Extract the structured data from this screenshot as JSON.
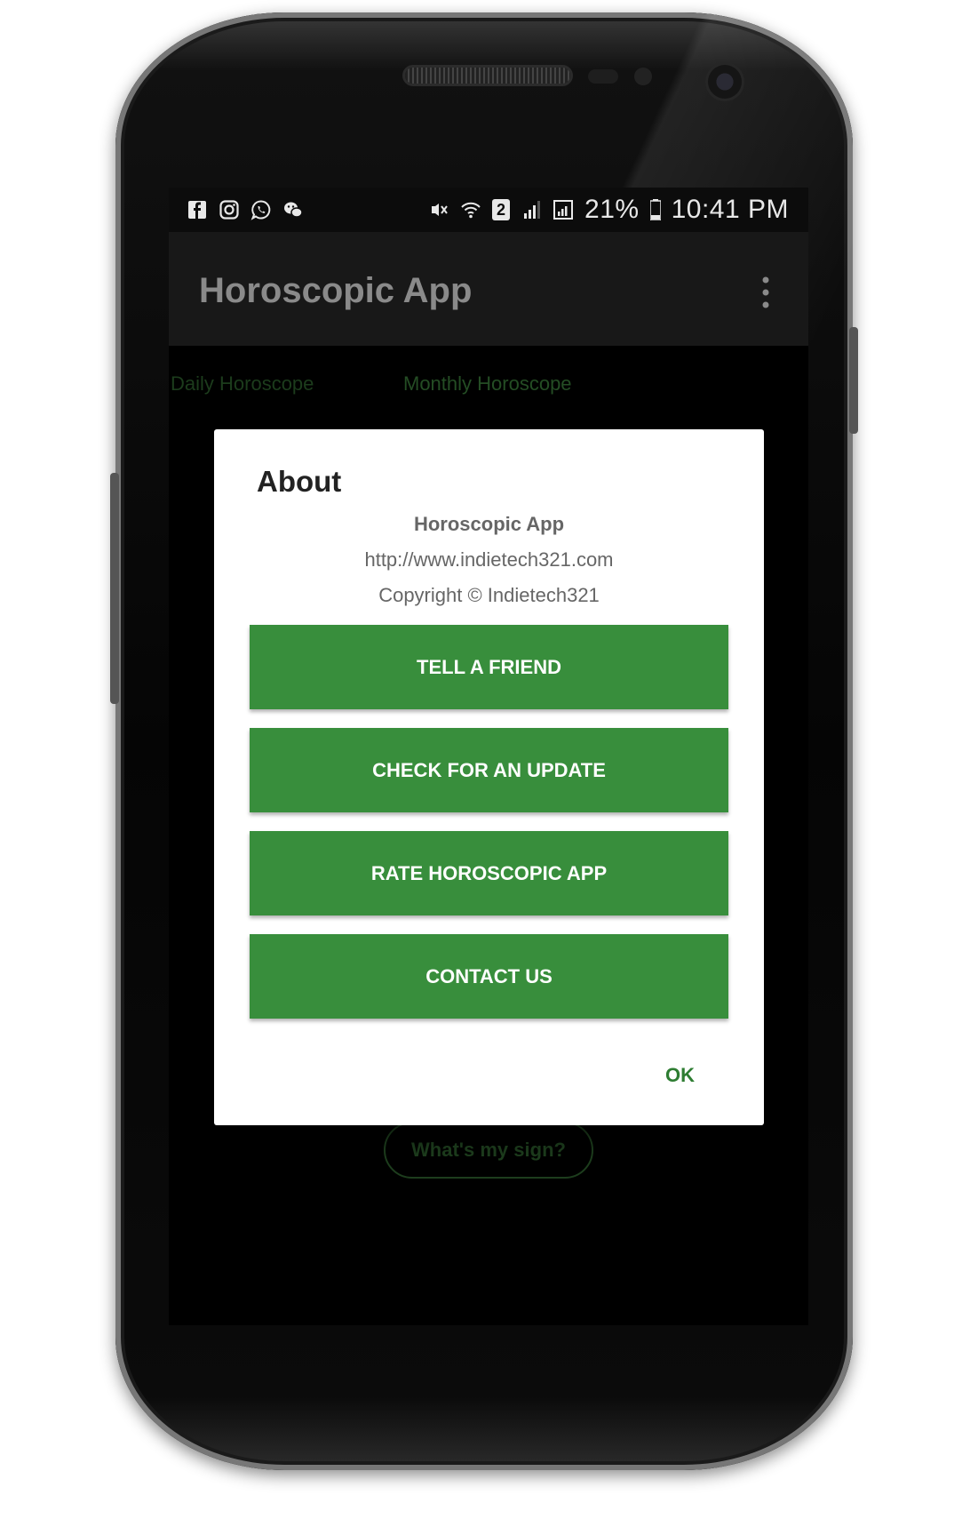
{
  "status_bar": {
    "battery": "21%",
    "time": "10:41 PM",
    "sim_slot": "2",
    "notification_icons": [
      "facebook-icon",
      "instagram-icon",
      "whatsapp-icon",
      "wechat-icon"
    ],
    "system_icons": [
      "mute-icon",
      "wifi-icon",
      "signal-icon",
      "signal-icon",
      "battery-icon"
    ]
  },
  "app_bar": {
    "title": "Horoscopic App"
  },
  "tabs": [
    {
      "label": "Daily Horoscope"
    },
    {
      "label": "Monthly Horoscope"
    }
  ],
  "background_button": {
    "label": "What's my sign?"
  },
  "dialog": {
    "title": "About",
    "app_name": "Horoscopic App",
    "url": "http://www.indietech321.com",
    "copyright": "Copyright © Indietech321",
    "buttons": [
      {
        "label": "TELL A FRIEND"
      },
      {
        "label": "CHECK FOR AN UPDATE"
      },
      {
        "label": "RATE HOROSCOPIC APP"
      },
      {
        "label": "CONTACT US"
      }
    ],
    "ok_label": "OK"
  },
  "colors": {
    "accent": "#388e3c",
    "ok_text": "#2e7d32",
    "screen_background": "#000000"
  }
}
